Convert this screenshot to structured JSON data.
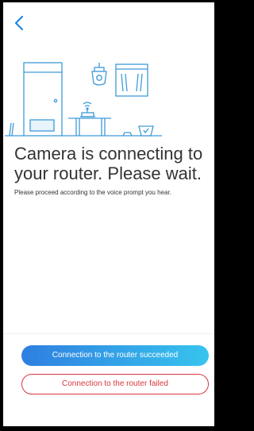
{
  "header": {
    "back_icon": "chevron-left-icon"
  },
  "main": {
    "title": "Camera is connecting to your router. Please wait.",
    "subtitle": "Please proceed according to the voice prompt you hear."
  },
  "actions": {
    "success_label": "Connection to the router succeeded",
    "failed_label": "Connection to the router failed"
  },
  "colors": {
    "accent": "#1e88e5",
    "success_gradient_start": "#2f7fe0",
    "success_gradient_end": "#37c4ee",
    "danger": "#d9363e",
    "illustration_stroke": "#3d9ad9"
  }
}
